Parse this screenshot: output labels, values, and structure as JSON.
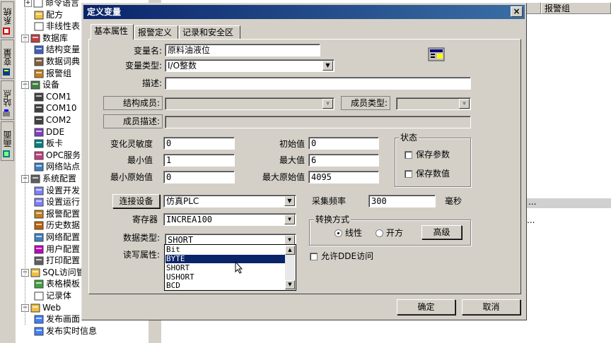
{
  "vertical_tabs": [
    "系统",
    "变量",
    "站点",
    "画面"
  ],
  "tree": [
    {
      "label": "命令语言",
      "depth": 2,
      "icon": "doc"
    },
    {
      "label": "配方",
      "depth": 2,
      "icon": "folder"
    },
    {
      "label": "非线性表",
      "depth": 2,
      "icon": "doc"
    },
    {
      "label": "数据库",
      "depth": 1,
      "icon": "database",
      "expander": "−"
    },
    {
      "label": "结构变量",
      "depth": 2,
      "icon": "struct"
    },
    {
      "label": "数据词典",
      "depth": 2,
      "icon": "book"
    },
    {
      "label": "报警组",
      "depth": 2,
      "icon": "alarm"
    },
    {
      "label": "设备",
      "depth": 1,
      "icon": "device",
      "expander": "−"
    },
    {
      "label": "COM1",
      "depth": 2,
      "icon": "com"
    },
    {
      "label": "COM10",
      "depth": 2,
      "icon": "com"
    },
    {
      "label": "COM2",
      "depth": 2,
      "icon": "com"
    },
    {
      "label": "DDE",
      "depth": 2,
      "icon": "dde"
    },
    {
      "label": "板卡",
      "depth": 2,
      "icon": "card"
    },
    {
      "label": "OPC服务",
      "depth": 2,
      "icon": "opc"
    },
    {
      "label": "网络站点",
      "depth": 2,
      "icon": "network"
    },
    {
      "label": "系统配置",
      "depth": 1,
      "icon": "tools",
      "expander": "−"
    },
    {
      "label": "设置开发",
      "depth": 2,
      "icon": "setting"
    },
    {
      "label": "设置运行",
      "depth": 2,
      "icon": "setting"
    },
    {
      "label": "报警配置",
      "depth": 2,
      "icon": "alarm"
    },
    {
      "label": "历史数据",
      "depth": 2,
      "icon": "history"
    },
    {
      "label": "网络配置",
      "depth": 2,
      "icon": "network"
    },
    {
      "label": "用户配置",
      "depth": 2,
      "icon": "user"
    },
    {
      "label": "打印配置",
      "depth": 2,
      "icon": "print"
    },
    {
      "label": "SQL访问管",
      "depth": 1,
      "icon": "folder",
      "expander": "−"
    },
    {
      "label": "表格模板",
      "depth": 2,
      "icon": "table"
    },
    {
      "label": "记录体",
      "depth": 2,
      "icon": "doc"
    },
    {
      "label": "Web",
      "depth": 1,
      "icon": "folder",
      "expander": "−"
    },
    {
      "label": "发布画面",
      "depth": 2,
      "icon": "web"
    },
    {
      "label": "发布实时信息",
      "depth": 2,
      "icon": "web"
    }
  ],
  "right_pane": {
    "column_header": "报警组",
    "selected_row_text": "...",
    "selected_row_text2": "..."
  },
  "dialog": {
    "title": "定义变量",
    "close_glyph": "×",
    "tabs": [
      "基本属性",
      "报警定义",
      "记录和安全区"
    ],
    "active_tab": 0,
    "var_name_label": "变量名:",
    "var_name_value": "原料油液位",
    "var_type_label": "变量类型:",
    "var_type_value": "I/O整数",
    "desc_label": "描述:",
    "desc_value": "",
    "struct_member_label": "结构成员:",
    "member_type_label": "成员类型:",
    "member_desc_label": "成员描述:",
    "sensitivity_label": "变化灵敏度",
    "sensitivity_value": "0",
    "initial_label": "初始值",
    "initial_value": "0",
    "min_label": "最小值",
    "min_value": "1",
    "max_label": "最大值",
    "max_value": "6",
    "min_raw_label": "最小原始值",
    "min_raw_value": "0",
    "max_raw_label": "最大原始值",
    "max_raw_value": "4095",
    "state_group_label": "状态",
    "save_param_label": "保存参数",
    "save_value_label": "保存数值",
    "connect_device_button": "连接设备",
    "device_value": "仿真PLC",
    "sample_freq_label": "采集频率",
    "sample_freq_value": "300",
    "sample_unit": "毫秒",
    "register_label": "寄存器",
    "register_value": "INCREA100",
    "convert_group_label": "转换方式",
    "linear_label": "线性",
    "sqrt_label": "开方",
    "advanced_button": "高级",
    "data_type_label": "数据类型:",
    "data_type_value": "SHORT",
    "rw_label": "读写属性:",
    "allow_dde_label": "允许DDE访问",
    "data_type_options": [
      "Bit",
      "BYTE",
      "SHORT",
      "USHORT",
      "BCD"
    ],
    "selected_option_index": 1,
    "ok_button": "确定",
    "cancel_button": "取消"
  },
  "colors": {
    "title_start": "#0a246a",
    "title_end": "#3a6ea5",
    "face": "#d4d0c8",
    "selection": "#0a246a"
  }
}
